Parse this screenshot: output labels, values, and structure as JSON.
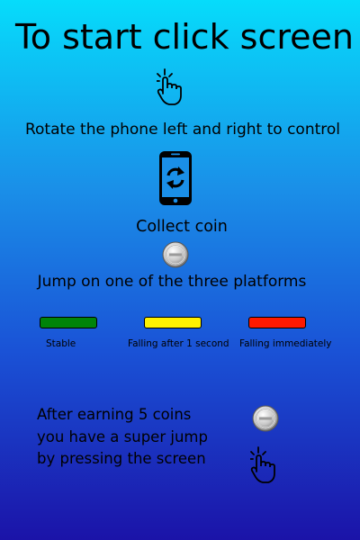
{
  "instructions": {
    "title": "To start click screen",
    "rotate": "Rotate the phone left and right to control",
    "collect": "Collect coin",
    "jump": "Jump on one of the three platforms",
    "platforms": [
      {
        "label": "Stable",
        "color": "#00840a"
      },
      {
        "label": "Falling after 1 second",
        "color": "#fff200"
      },
      {
        "label": "Falling immediately",
        "color": "#ff1a00"
      }
    ],
    "super_jump": [
      "After earning 5 coins",
      "you have a super jump",
      "by pressing the screen"
    ]
  },
  "icons": [
    "tap-hand-icon",
    "rotate-phone-icon",
    "coin-icon"
  ]
}
